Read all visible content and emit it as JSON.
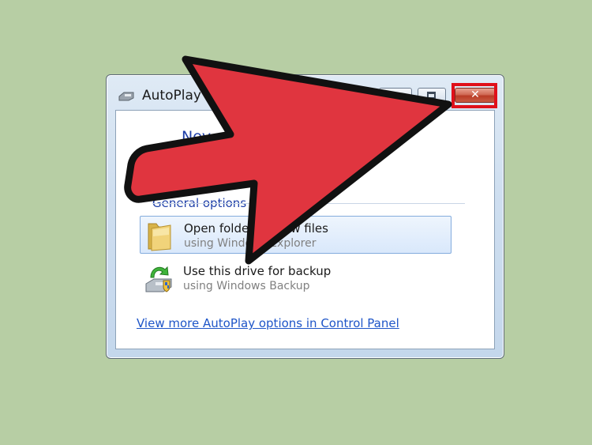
{
  "window": {
    "title": "AutoPlay",
    "drive_heading": "Nev",
    "buttons": {
      "close_glyph": "✕"
    }
  },
  "general_options": {
    "label": "General options",
    "items": [
      {
        "title": "Open folder to view files",
        "subtitle": "using Windows Explorer",
        "icon": "folder-icon"
      },
      {
        "title": "Use this drive for backup",
        "subtitle": "using Windows Backup",
        "icon": "backup-drive-icon"
      }
    ]
  },
  "more_link": "View more AutoPlay options in Control Panel",
  "colors": {
    "background": "#b7cea4",
    "arrow": "#e0353f",
    "highlight": "#e0101a",
    "link": "#1e55c8"
  }
}
